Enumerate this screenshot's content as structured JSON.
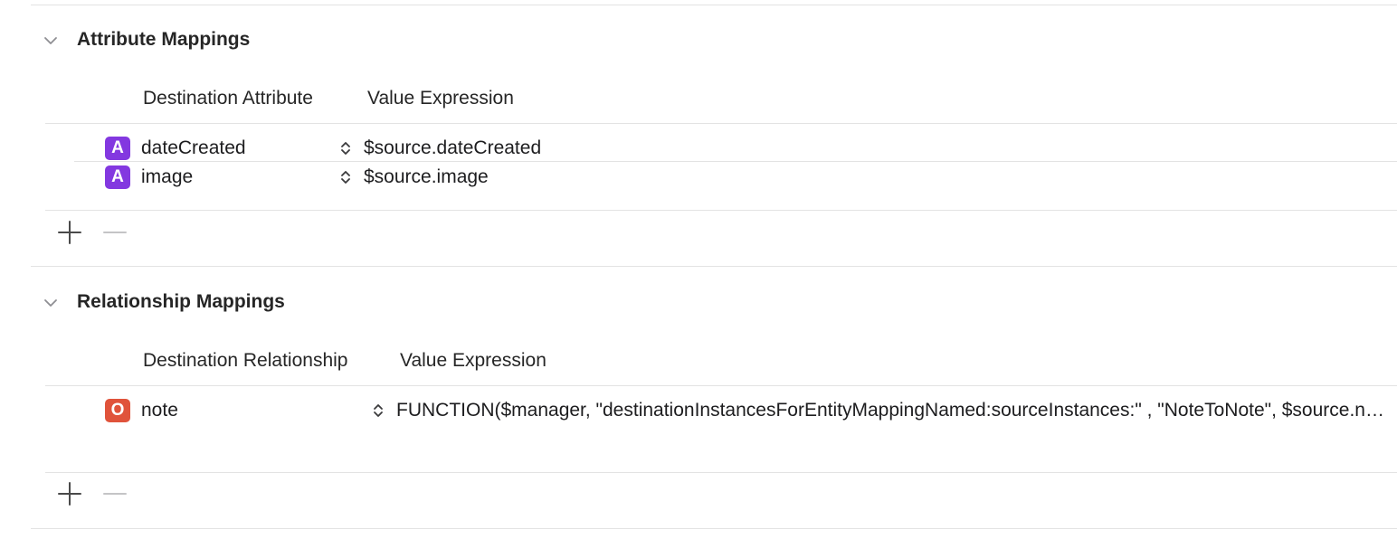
{
  "attribute_mappings": {
    "title": "Attribute Mappings",
    "columns": {
      "destination": "Destination Attribute",
      "value_expression": "Value Expression"
    },
    "rows": [
      {
        "badge": "A",
        "name": "dateCreated",
        "value": "$source.dateCreated"
      },
      {
        "badge": "A",
        "name": "image",
        "value": "$source.image"
      }
    ],
    "add_icon": "plus-icon",
    "remove_icon": "minus-icon"
  },
  "relationship_mappings": {
    "title": "Relationship Mappings",
    "columns": {
      "destination": "Destination Relationship",
      "value_expression": "Value Expression"
    },
    "rows": [
      {
        "badge": "O",
        "name": "note",
        "value": "FUNCTION($manager, \"destinationInstancesForEntityMappingNamed:sourceInstances:\" , \"NoteToNote\", $source.note)"
      }
    ],
    "add_icon": "plus-icon",
    "remove_icon": "minus-icon"
  },
  "colors": {
    "attribute_badge": "#8338e0",
    "relationship_badge": "#e0533b",
    "divider": "#e3e3e3"
  }
}
